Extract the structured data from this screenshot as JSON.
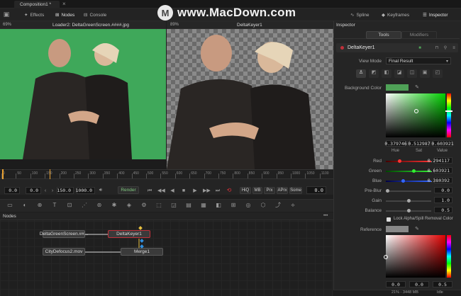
{
  "watermark": {
    "text": "www.MacDown.com"
  },
  "titlebar": {
    "tab": "Composition1 *",
    "tab_close": "×"
  },
  "toolbar": {
    "effects": "Effects",
    "nodes": "Nodes",
    "console": "Console",
    "spline": "Spline",
    "keyframes": "Keyframes",
    "inspector": "Inspector"
  },
  "viewer_left": {
    "zoom": "69%",
    "title": "Loader2: DeltaGreenScreen.####.jpg"
  },
  "viewer_right": {
    "zoom": "89%",
    "title": "DeltaKeyer1"
  },
  "ruler": {
    "ticks": [
      "0",
      "50",
      "100",
      "150",
      "200",
      "250",
      "300",
      "350",
      "400",
      "450",
      "500",
      "550",
      "600",
      "650",
      "700",
      "750",
      "800",
      "850",
      "900",
      "950",
      "1000",
      "1050",
      "1100"
    ]
  },
  "transport": {
    "current": "0.0",
    "start": "0.0",
    "end": "150.0",
    "total": "1000.0",
    "render": "Render",
    "hiq": "HiQ",
    "mb": "MB",
    "prx": "Prx",
    "aprx": "APrx",
    "some": "Some",
    "frame": "0.0"
  },
  "nodes_panel": {
    "title": "Nodes",
    "menu": "•••",
    "n1": "DeltaGreenScreen.##...",
    "n2": "DeltaKeyer1",
    "n3": "CityDefocus2.mov",
    "n4": "Merge1"
  },
  "inspector": {
    "title": "Inspector",
    "tab_tools": "Tools",
    "tab_modifiers": "Modifiers",
    "node_name": "DeltaKeyer1",
    "view_mode_label": "View Mode",
    "view_mode_value": "Final Result",
    "bg_color_label": "Background Color",
    "hue": "0.379746",
    "sat": "0.512987",
    "val": "0.603921",
    "hue_label": "Hue",
    "sat_label": "Sat",
    "val_label": "Value",
    "red_label": "Red",
    "red": "0.294117",
    "green_label": "Green",
    "green": "0.603921",
    "blue_label": "Blue",
    "blue": "0.380392",
    "preblur_label": "Pre-Blur",
    "preblur": "0.0",
    "gain_label": "Gain",
    "gain": "1.0",
    "balance_label": "Balance",
    "balance": "0.5",
    "lock_label": "Lock Alpha/Spill Removal Color",
    "reference_label": "Reference",
    "ref_a": "0.0",
    "ref_b": "0.0",
    "ref_c": "0.5"
  },
  "statusbar": {
    "memory": "21% - 3448 MB",
    "idle": "Idle"
  },
  "colors": {
    "bg_swatch": "#4fa157",
    "reference_swatch": "#888888",
    "accent_orange": "#e8a030",
    "keyer_red": "#c0303a",
    "render_green": "#7fc87f"
  }
}
